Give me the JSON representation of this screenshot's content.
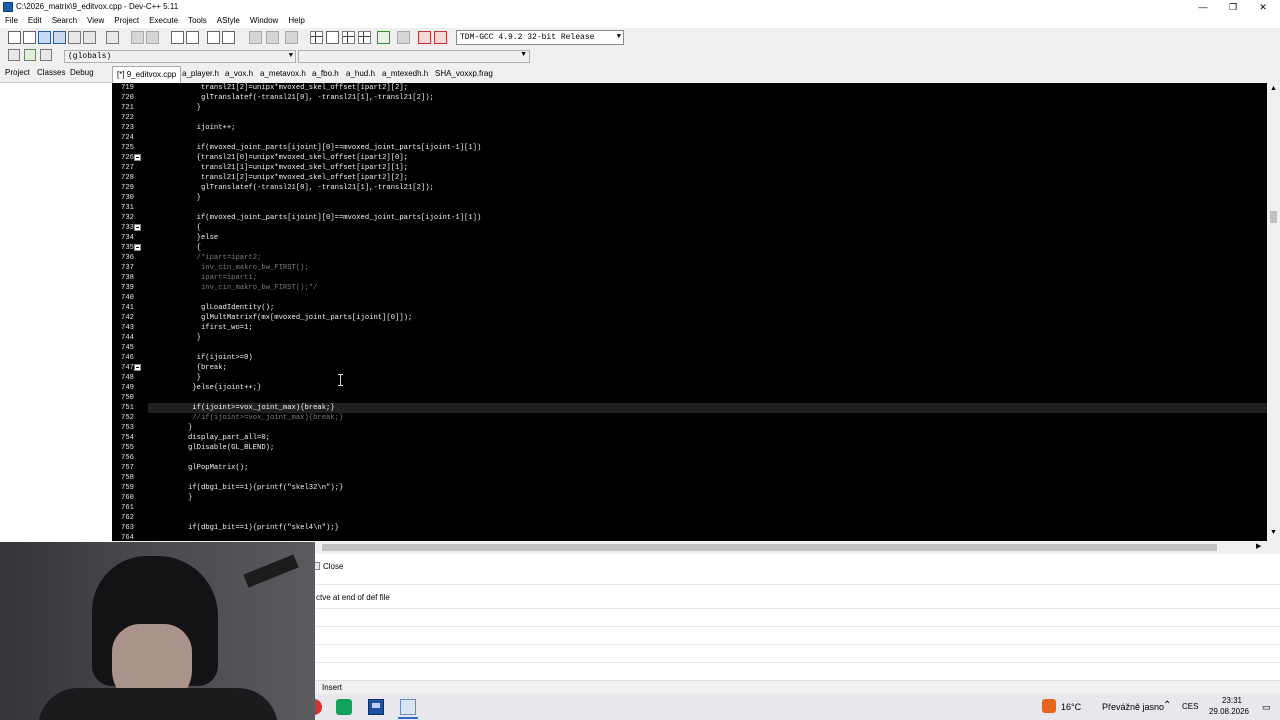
{
  "window": {
    "title": "C:\\2026_matrix\\9_editvox.cpp - Dev-C++ 5.11"
  },
  "menu": [
    "File",
    "Edit",
    "Search",
    "View",
    "Project",
    "Execute",
    "Tools",
    "AStyle",
    "Window",
    "Help"
  ],
  "toolbar": {
    "compiler": "TDM-GCC 4.9.2 32-bit Release",
    "scope": "(globals)"
  },
  "left_tabs": [
    "Project",
    "Classes",
    "Debug"
  ],
  "file_tabs": [
    "[*] 9_editvox.cpp",
    "a_player.h",
    "a_vox.h",
    "a_metavox.h",
    "a_fbo.h",
    "a_hud.h",
    "a_mtexedh.h",
    "SHA_voxxp.frag"
  ],
  "code_lines": [
    {
      "n": "719",
      "t": "   transl21[2]=unipx*mvoxed_skel_offset[ipart2][2];"
    },
    {
      "n": "720",
      "t": "   glTranslatef(-transl21[0], -transl21[1],-transl21[2]);"
    },
    {
      "n": "721",
      "t": "  }"
    },
    {
      "n": "722",
      "t": ""
    },
    {
      "n": "723",
      "t": "  ijoint++;"
    },
    {
      "n": "724",
      "t": ""
    },
    {
      "n": "725",
      "t": "  if(mvoxed_joint_parts[ijoint][0]==mvoxed_joint_parts[ijoint-1][1])"
    },
    {
      "n": "726",
      "t": "  {transl21[0]=unipx*mvoxed_skel_offset[ipart2][0];"
    },
    {
      "n": "727",
      "t": "   transl21[1]=unipx*mvoxed_skel_offset[ipart2][1];"
    },
    {
      "n": "728",
      "t": "   transl21[2]=unipx*mvoxed_skel_offset[ipart2][2];"
    },
    {
      "n": "729",
      "t": "   glTranslatef(-transl21[0], -transl21[1],-transl21[2]);"
    },
    {
      "n": "730",
      "t": "  }"
    },
    {
      "n": "731",
      "t": ""
    },
    {
      "n": "732",
      "t": "  if(mvoxed_joint_parts[ijoint][0]==mvoxed_joint_parts[ijoint-1][1])"
    },
    {
      "n": "733",
      "t": "  {"
    },
    {
      "n": "734",
      "t": "  }else"
    },
    {
      "n": "735",
      "t": "  {"
    },
    {
      "n": "736",
      "t": "  /*ipart=ipart2;",
      "c": true
    },
    {
      "n": "737",
      "t": "   inv_cin_makro_bw_FIRST();",
      "c": true
    },
    {
      "n": "738",
      "t": "   ipart=ipart1;",
      "c": true
    },
    {
      "n": "739",
      "t": "   inv_cin_makro_bw_FIRST();*/",
      "c": true
    },
    {
      "n": "740",
      "t": ""
    },
    {
      "n": "741",
      "t": "   glLoadIdentity();"
    },
    {
      "n": "742",
      "t": "   glMultMatrixf(mx[mvoxed_joint_parts[ijoint][0]]);"
    },
    {
      "n": "743",
      "t": "   ifirst_wo=1;"
    },
    {
      "n": "744",
      "t": "  }"
    },
    {
      "n": "745",
      "t": ""
    },
    {
      "n": "746",
      "t": "  if(ijoint>=0)"
    },
    {
      "n": "747",
      "t": "  {break;"
    },
    {
      "n": "748",
      "t": "  }"
    },
    {
      "n": "749",
      "t": " }else{ijoint++;}"
    },
    {
      "n": "750",
      "t": ""
    },
    {
      "n": "751",
      "t": " if(ijoint>=vox_joint_max){break;}"
    },
    {
      "n": "752",
      "t": " //if(ijoint>=vox_joint_max){break;}",
      "c": true
    },
    {
      "n": "753",
      "t": "}"
    },
    {
      "n": "754",
      "t": "display_part_all=0;"
    },
    {
      "n": "755",
      "t": "glDisable(GL_BLEND);"
    },
    {
      "n": "756",
      "t": ""
    },
    {
      "n": "757",
      "t": "glPopMatrix();"
    },
    {
      "n": "758",
      "t": ""
    },
    {
      "n": "759",
      "t": "if(dbg1_bit==1){printf(\"skel32\\n\");}"
    },
    {
      "n": "760",
      "t": "}"
    },
    {
      "n": "761",
      "t": ""
    },
    {
      "n": "762",
      "t": ""
    },
    {
      "n": "763",
      "t": "if(dbg1_bit==1){printf(\"skel4\\n\");}"
    },
    {
      "n": "764",
      "t": ""
    }
  ],
  "bottom": {
    "close_label": "Close",
    "message": "ctve at end of def file"
  },
  "status": {
    "mode": "Insert"
  },
  "taskbar": {
    "temperature": "16°C",
    "weather": "Převážně jasno",
    "language": "CES",
    "time": "23:31",
    "date": "29.08.2026"
  },
  "colors": {
    "editor_bg": "#000000",
    "code_text": "#f4f4f4",
    "comment": "#7a7a7a",
    "current_line": "#202020"
  }
}
